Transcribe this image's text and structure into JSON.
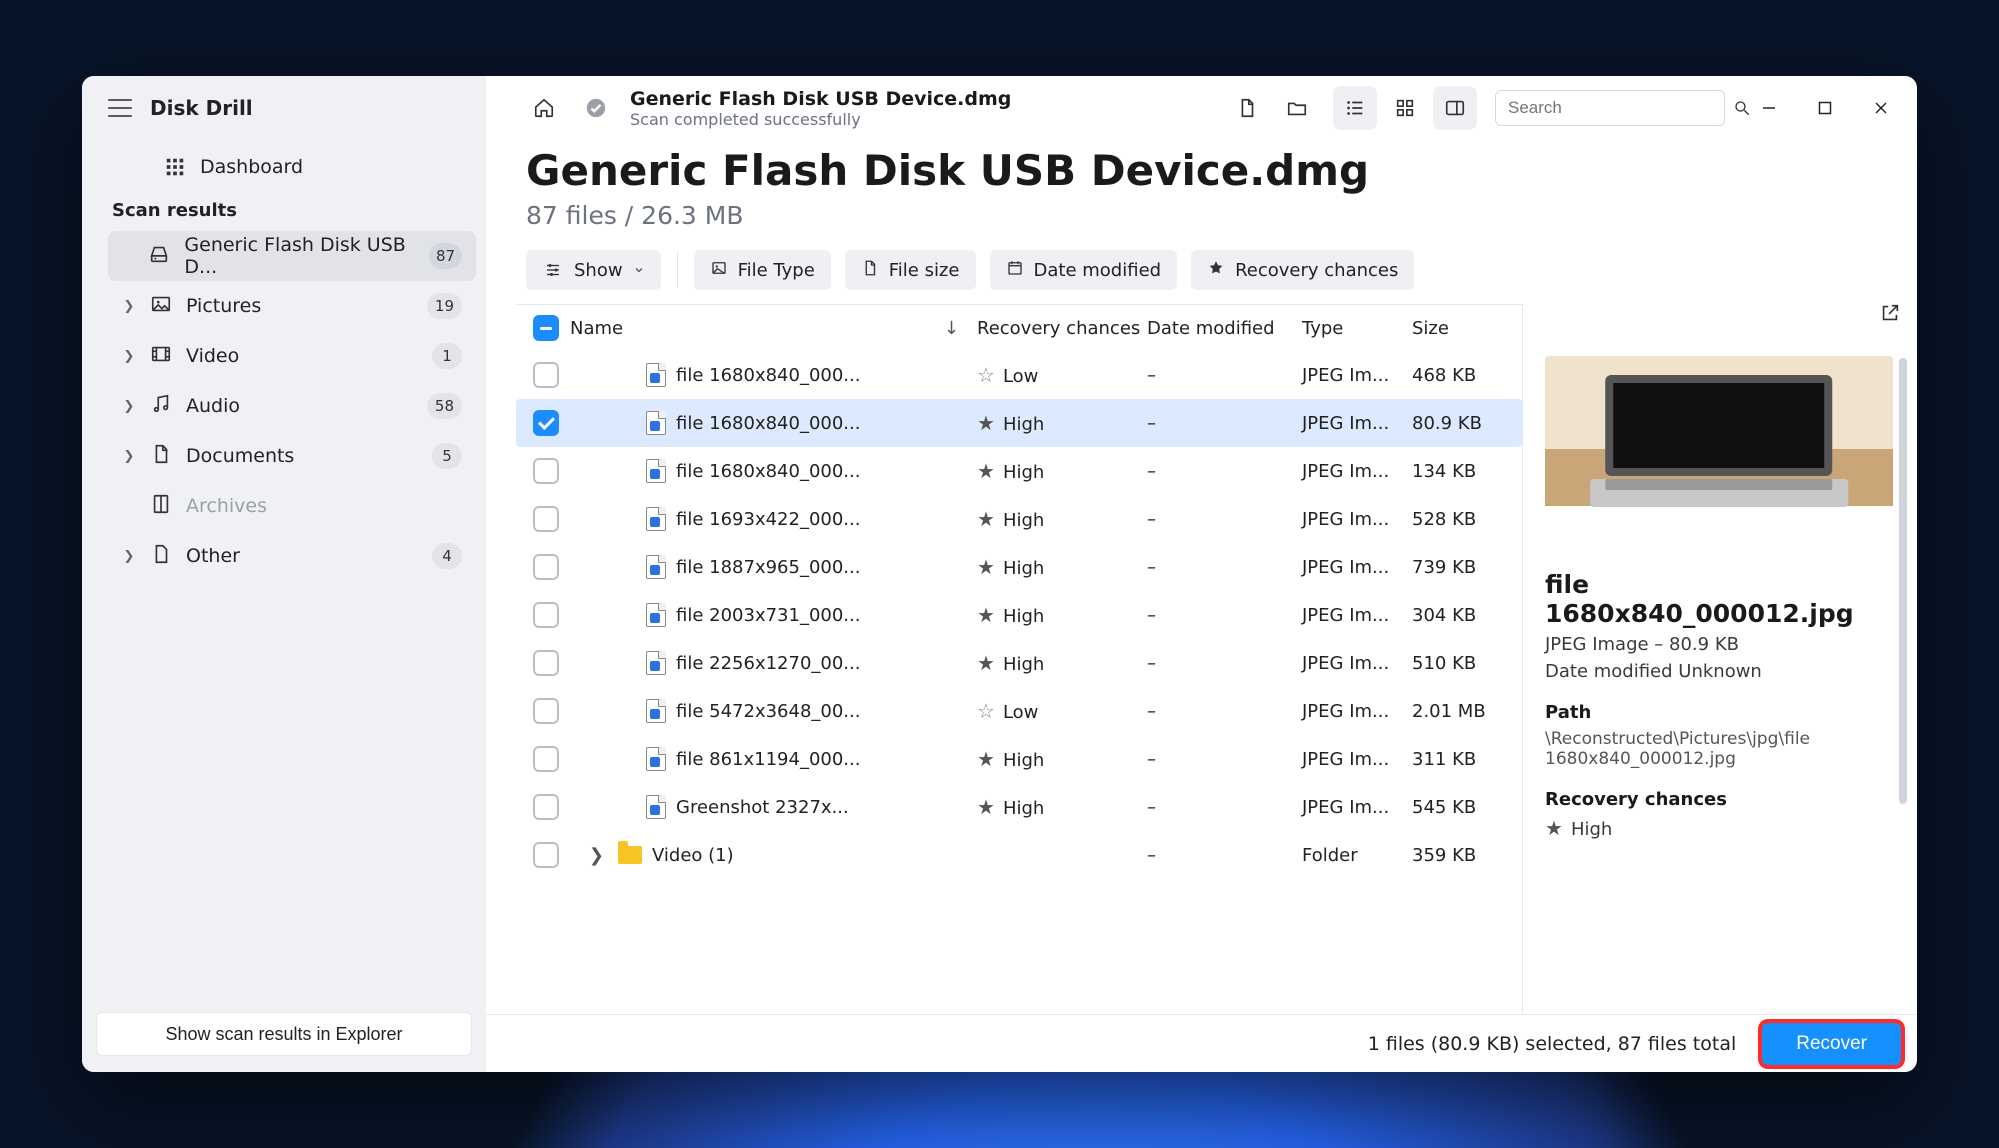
{
  "app_name": "Disk Drill",
  "sidebar": {
    "dashboard": "Dashboard",
    "section": "Scan results",
    "items": [
      {
        "label": "Generic Flash Disk USB D...",
        "count": "87",
        "active": true,
        "icon": "drive"
      },
      {
        "label": "Pictures",
        "count": "19",
        "icon": "image",
        "chev": true
      },
      {
        "label": "Video",
        "count": "1",
        "icon": "video",
        "chev": true
      },
      {
        "label": "Audio",
        "count": "58",
        "icon": "audio",
        "chev": true
      },
      {
        "label": "Documents",
        "count": "5",
        "icon": "doc",
        "chev": true
      },
      {
        "label": "Archives",
        "count": "",
        "icon": "archive",
        "faded": true
      },
      {
        "label": "Other",
        "count": "4",
        "icon": "other",
        "chev": true
      }
    ],
    "footer_button": "Show scan results in Explorer"
  },
  "topbar": {
    "title": "Generic Flash Disk USB Device.dmg",
    "subtitle": "Scan completed successfully",
    "search_placeholder": "Search"
  },
  "header": {
    "title": "Generic Flash Disk USB Device.dmg",
    "subtitle": "87 files / 26.3 MB"
  },
  "filters": {
    "show": "Show",
    "pills": [
      "File Type",
      "File size",
      "Date modified",
      "Recovery chances"
    ]
  },
  "columns": {
    "name": "Name",
    "rec": "Recovery chances",
    "date": "Date modified",
    "type": "Type",
    "size": "Size"
  },
  "rows": [
    {
      "name": "file 1680x840_000...",
      "rec": "Low",
      "star": "empty",
      "date": "–",
      "type": "JPEG Im...",
      "size": "468 KB"
    },
    {
      "name": "file 1680x840_000...",
      "rec": "High",
      "star": "full",
      "date": "–",
      "type": "JPEG Im...",
      "size": "80.9 KB",
      "selected": true
    },
    {
      "name": "file 1680x840_000...",
      "rec": "High",
      "star": "full",
      "date": "–",
      "type": "JPEG Im...",
      "size": "134 KB"
    },
    {
      "name": "file 1693x422_000...",
      "rec": "High",
      "star": "full",
      "date": "–",
      "type": "JPEG Im...",
      "size": "528 KB"
    },
    {
      "name": "file 1887x965_000...",
      "rec": "High",
      "star": "full",
      "date": "–",
      "type": "JPEG Im...",
      "size": "739 KB"
    },
    {
      "name": "file 2003x731_000...",
      "rec": "High",
      "star": "full",
      "date": "–",
      "type": "JPEG Im...",
      "size": "304 KB"
    },
    {
      "name": "file 2256x1270_00...",
      "rec": "High",
      "star": "full",
      "date": "–",
      "type": "JPEG Im...",
      "size": "510 KB"
    },
    {
      "name": "file 5472x3648_00...",
      "rec": "Low",
      "star": "empty",
      "date": "–",
      "type": "JPEG Im...",
      "size": "2.01 MB"
    },
    {
      "name": "file 861x1194_000...",
      "rec": "High",
      "star": "full",
      "date": "–",
      "type": "JPEG Im...",
      "size": "311 KB"
    },
    {
      "name": "Greenshot 2327x...",
      "rec": "High",
      "star": "full",
      "date": "–",
      "type": "JPEG Im...",
      "size": "545 KB"
    }
  ],
  "folder_row": {
    "name": "Video (1)",
    "date": "–",
    "type": "Folder",
    "size": "359 KB"
  },
  "preview": {
    "title": "file 1680x840_000012.jpg",
    "meta": "JPEG Image – 80.9 KB",
    "modified": "Date modified Unknown",
    "path_label": "Path",
    "path": "\\Reconstructed\\Pictures\\jpg\\file 1680x840_000012.jpg",
    "rec_label": "Recovery chances",
    "rec": "High"
  },
  "footer": {
    "status": "1 files (80.9 KB) selected, 87 files total",
    "button": "Recover"
  }
}
